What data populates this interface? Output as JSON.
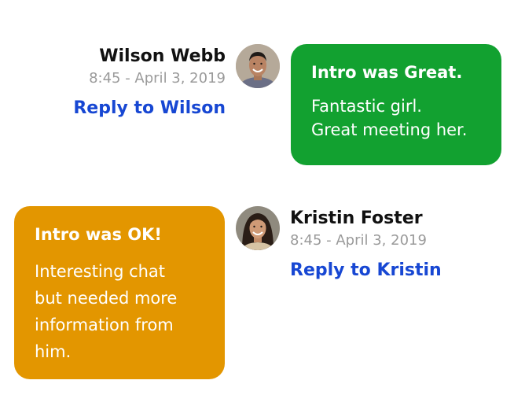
{
  "messages": [
    {
      "author": "Wilson Webb",
      "timestamp": "8:45 - April 3, 2019",
      "reply_label": "Reply to Wilson",
      "bubble_title": "Intro was Great.",
      "bubble_lines": [
        "Fantastic girl.",
        "Great meeting her."
      ],
      "bubble_color": "#12a130"
    },
    {
      "author": "Kristin Foster",
      "timestamp": "8:45 - April 3, 2019",
      "reply_label": "Reply to Kristin",
      "bubble_title": "Intro was OK!",
      "bubble_lines": [
        "Interesting chat",
        "but needed more",
        "information from",
        "him."
      ],
      "bubble_color": "#e39600"
    }
  ],
  "colors": {
    "reply_link": "#1747d3",
    "timestamp": "#9a9a9a",
    "name": "#111111"
  }
}
